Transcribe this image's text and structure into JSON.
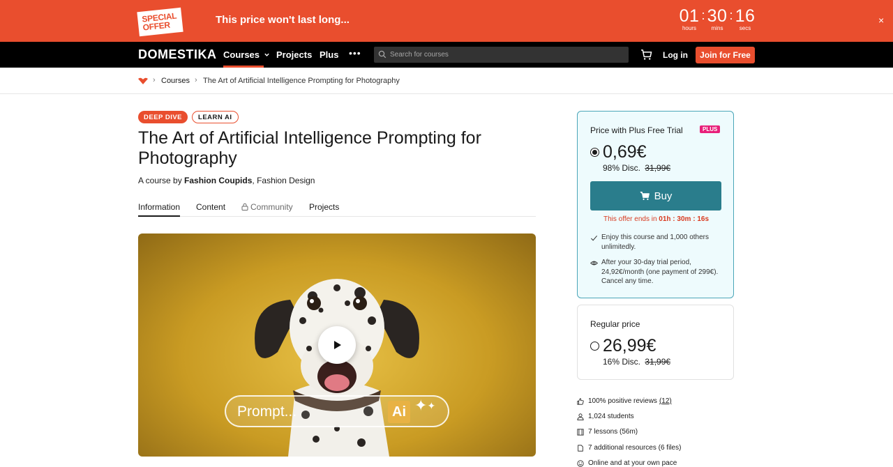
{
  "promo": {
    "badge": "SPECIAL OFFER",
    "message": "This price won't last long...",
    "countdown": [
      {
        "value": "01",
        "label": "hours"
      },
      {
        "value": "30",
        "label": "mins"
      },
      {
        "value": "16",
        "label": "secs"
      }
    ],
    "close": "×"
  },
  "nav": {
    "logo": "DOMESTIKA",
    "courses": "Courses",
    "projects": "Projects",
    "plus": "Plus",
    "more": "•••",
    "search_placeholder": "Search for courses",
    "login": "Log in",
    "join": "Join for Free"
  },
  "breadcrumb": {
    "courses": "Courses",
    "current": "The Art of Artificial Intelligence Prompting for Photography"
  },
  "course": {
    "tags": [
      "DEEP DIVE",
      "LEARN AI"
    ],
    "title": "The Art of Artificial Intelligence Prompting for Photography",
    "byline_prefix": "A course by",
    "author": "Fashion Coupids",
    "category": "Fashion Design",
    "tabs": [
      "Information",
      "Content",
      "Community",
      "Projects"
    ],
    "video_prompt": "Prompt...",
    "video_ai": "Ai"
  },
  "pricing": {
    "plus_card": {
      "label": "Price with Plus Free Trial",
      "badge": "PLUS",
      "price": "0,69€",
      "disc": "98% Disc.",
      "original": "31,99€",
      "buy": "Buy",
      "offer_prefix": "This offer ends in",
      "offer_time": "01h : 30m : 16s",
      "perks": [
        "Enjoy this course and 1,000 others unlimitedly.",
        "After your 30-day trial period, 24,92€/month (one payment of 299€). Cancel any time."
      ]
    },
    "regular_card": {
      "label": "Regular price",
      "price": "26,99€",
      "disc": "16% Disc.",
      "original": "31,99€"
    }
  },
  "stats": {
    "reviews": "100% positive reviews",
    "reviews_count": "(12)",
    "students": "1,024 students",
    "lessons": "7 lessons (56m)",
    "resources": "7 additional resources (6 files)",
    "pace": "Online and at your own pace"
  },
  "colors": {
    "brand": "#e94e2e",
    "teal": "#2a7d8c",
    "plus_pink": "#e8207a"
  }
}
